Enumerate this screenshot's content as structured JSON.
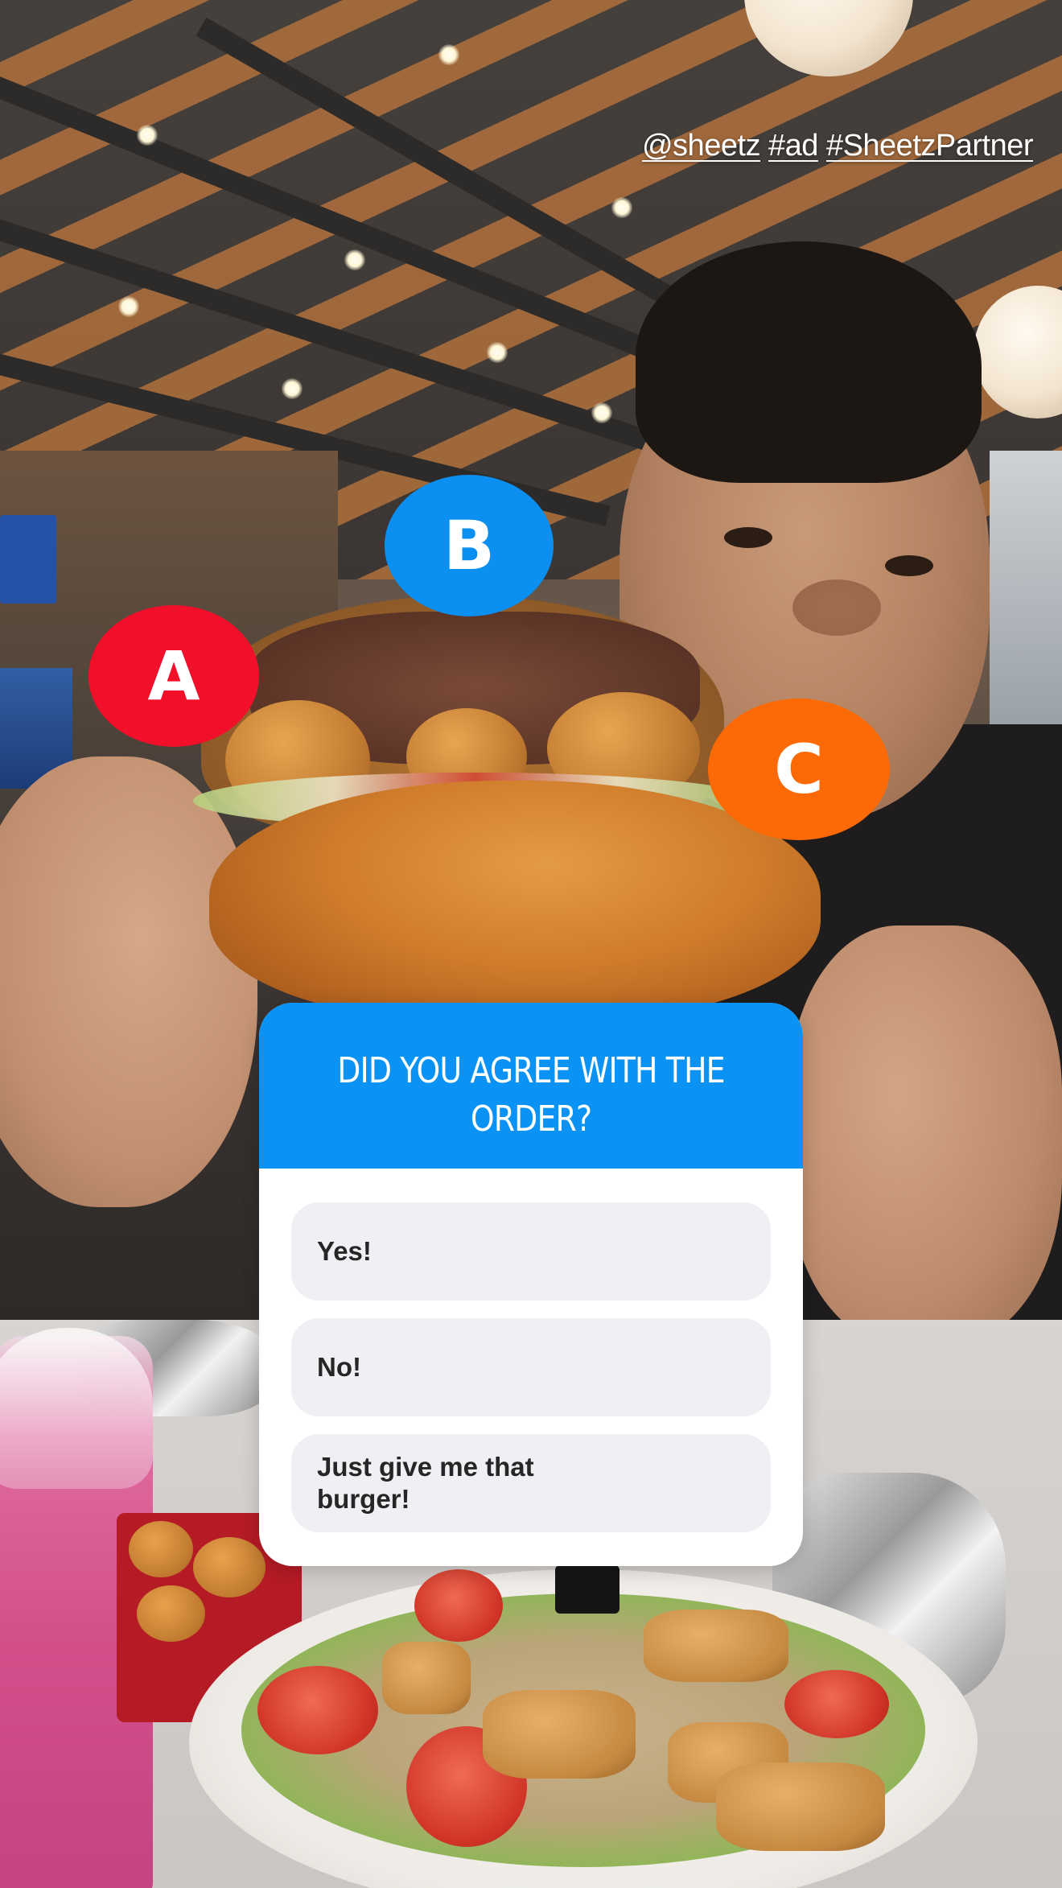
{
  "story": {
    "tags": [
      "@sheetz",
      "#ad",
      "#SheetzPartner"
    ]
  },
  "markers": {
    "a": "A",
    "b": "B",
    "c": "C"
  },
  "quiz": {
    "title": "DID YOU AGREE WITH THE ORDER?",
    "options": [
      "Yes!",
      "No!",
      "Just give me that burger!"
    ]
  },
  "colors": {
    "marker_a": "#f20f2a",
    "marker_b": "#0b8ff0",
    "marker_c": "#fb6a07",
    "quiz_header": "#0a92f5",
    "option_bg": "#eff0f3"
  }
}
